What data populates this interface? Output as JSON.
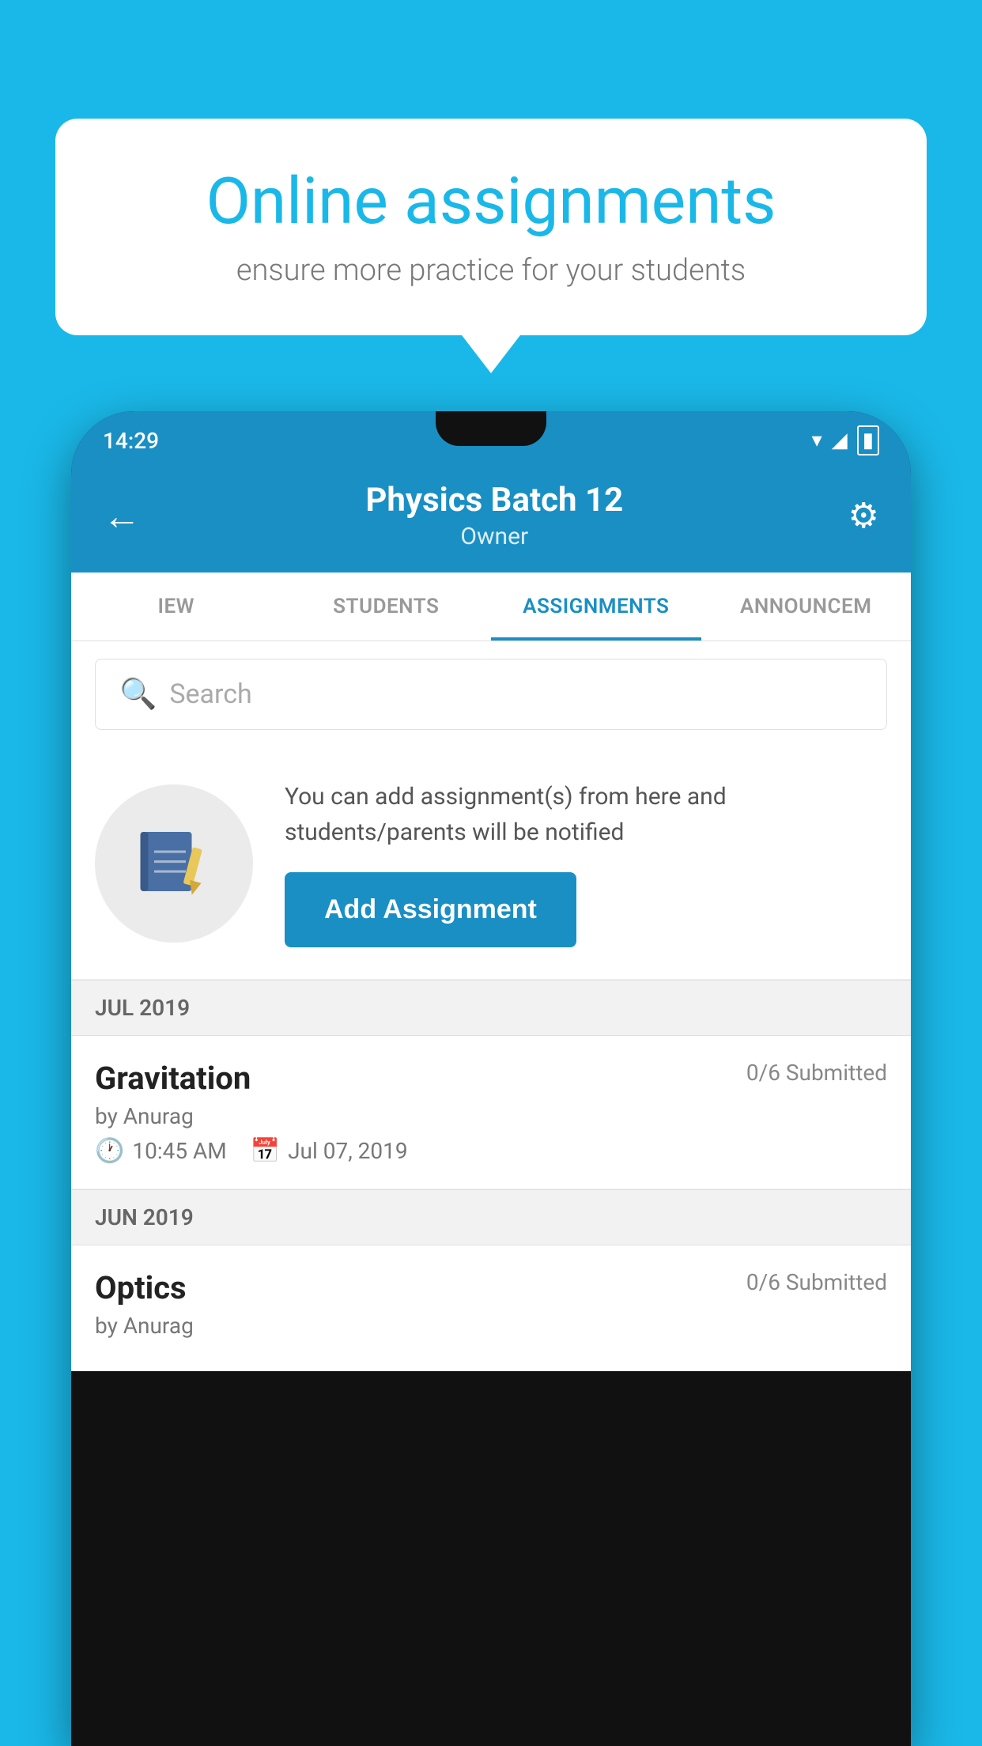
{
  "background_color": "#1ab8e8",
  "speech_bubble": {
    "title": "Online assignments",
    "subtitle": "ensure more practice for your students"
  },
  "status_bar": {
    "time": "14:29",
    "wifi_icon": "wifi",
    "signal_icon": "signal",
    "battery_icon": "battery"
  },
  "header": {
    "title": "Physics Batch 12",
    "subtitle": "Owner",
    "back_label": "←",
    "settings_label": "⚙"
  },
  "tabs": [
    {
      "label": "IEW",
      "active": false
    },
    {
      "label": "STUDENTS",
      "active": false
    },
    {
      "label": "ASSIGNMENTS",
      "active": true
    },
    {
      "label": "ANNOUNCEM",
      "active": false
    }
  ],
  "search": {
    "placeholder": "Search",
    "icon": "🔍"
  },
  "promo": {
    "description": "You can add assignment(s) from here and students/parents will be notified",
    "button_label": "Add Assignment"
  },
  "sections": [
    {
      "label": "JUL 2019",
      "assignments": [
        {
          "name": "Gravitation",
          "submitted": "0/6 Submitted",
          "author": "by Anurag",
          "time": "10:45 AM",
          "date": "Jul 07, 2019"
        }
      ]
    },
    {
      "label": "JUN 2019",
      "assignments": [
        {
          "name": "Optics",
          "submitted": "0/6 Submitted",
          "author": "by Anurag",
          "time": "",
          "date": ""
        }
      ]
    }
  ]
}
